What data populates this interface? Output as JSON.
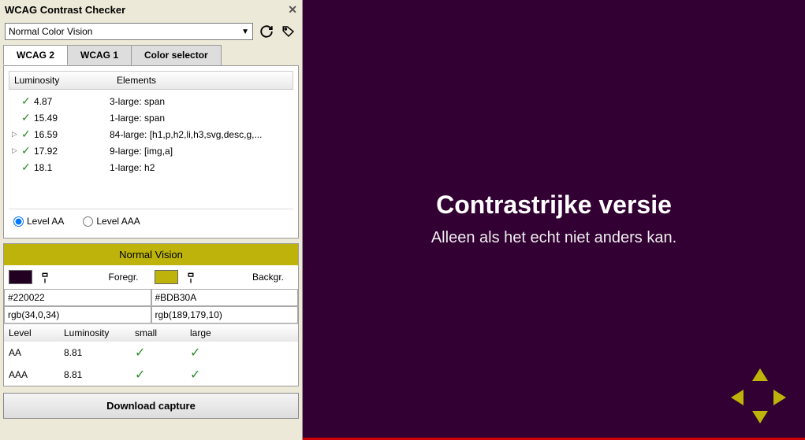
{
  "panel": {
    "title": "WCAG Contrast Checker",
    "visionSelect": "Normal Color Vision",
    "tabs": [
      "WCAG 2",
      "WCAG 1",
      "Color selector"
    ],
    "activeTab": 0,
    "columns": {
      "lum": "Luminosity",
      "el": "Elements"
    },
    "rows": [
      {
        "expand": "",
        "lum": "4.87",
        "el": "3-large: span"
      },
      {
        "expand": "",
        "lum": "15.49",
        "el": "1-large: span"
      },
      {
        "expand": "▷",
        "lum": "16.59",
        "el": "84-large: [h1,p,h2,li,h3,svg,desc,g,..."
      },
      {
        "expand": "▷",
        "lum": "17.92",
        "el": "9-large: [img,a]"
      },
      {
        "expand": "",
        "lum": "18.1",
        "el": "1-large: h2"
      }
    ],
    "radios": {
      "aa": "Level AA",
      "aaa": "Level AAA"
    },
    "radioSelected": "aa"
  },
  "colorPanel": {
    "header": "Normal Vision",
    "foreLabel": "Foregr.",
    "backLabel": "Backgr.",
    "foreHex": "#220022",
    "backHex": "#BDB30A",
    "foreRgb": "rgb(34,0,34)",
    "backRgb": "rgb(189,179,10)",
    "levHead": {
      "level": "Level",
      "lum": "Luminosity",
      "small": "small",
      "large": "large"
    },
    "levRows": [
      {
        "level": "AA",
        "lum": "8.81",
        "small": "✓",
        "large": "✓"
      },
      {
        "level": "AAA",
        "lum": "8.81",
        "small": "✓",
        "large": "✓"
      }
    ]
  },
  "downloadBtn": "Download capture",
  "preview": {
    "heading": "Contrastrijke versie",
    "sub": "Alleen als het echt niet anders kan."
  }
}
